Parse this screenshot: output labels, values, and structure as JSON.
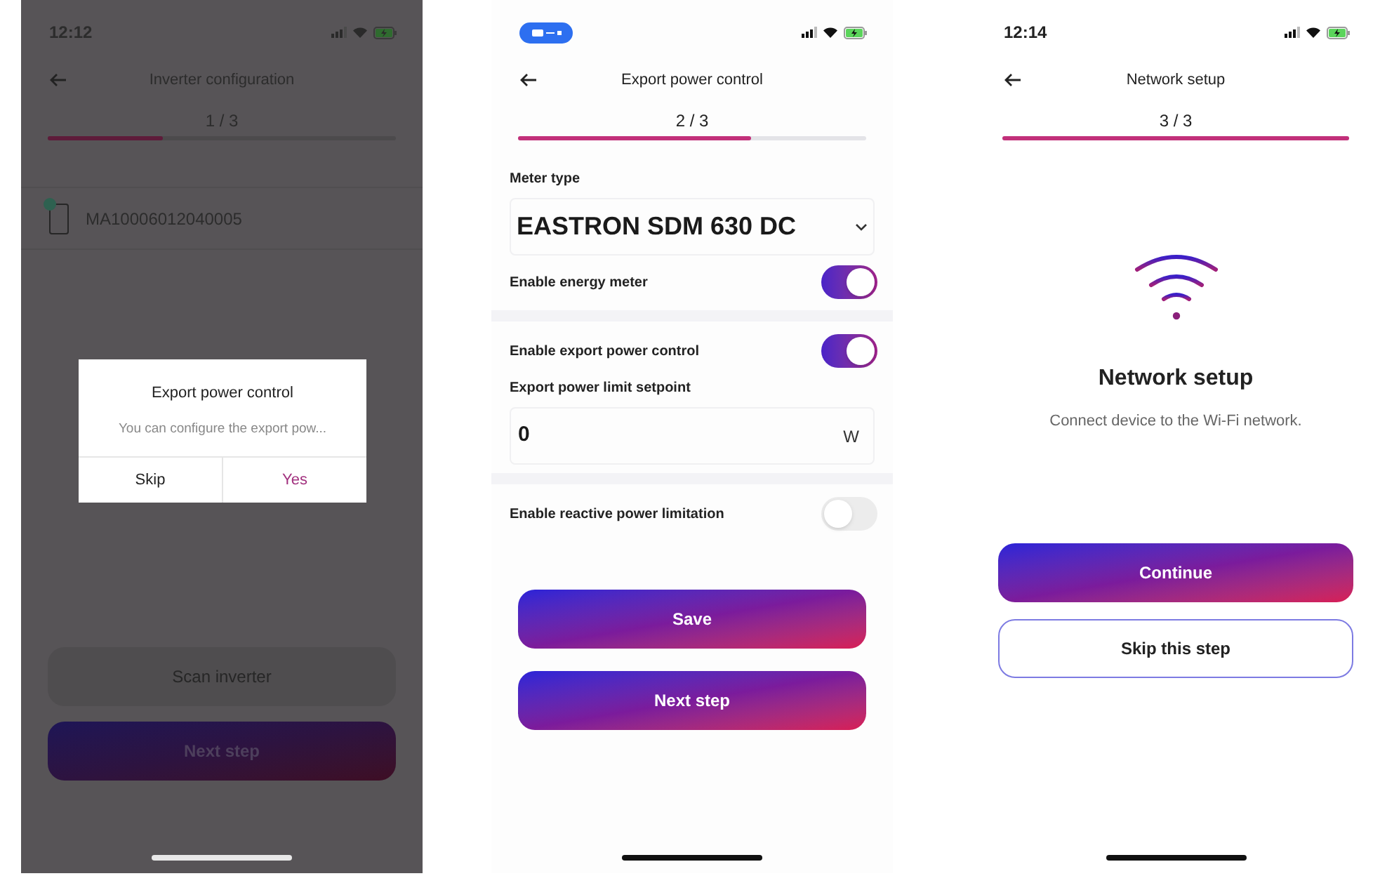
{
  "screens": [
    {
      "kind": "inverter_config",
      "time": "12:12",
      "title": "Inverter configuration",
      "step": "1 / 3",
      "progress": {
        "level": 0.33
      },
      "devices": [
        {
          "serial": "MA10006012040005",
          "connected": true
        }
      ],
      "dialog": {
        "title": "Export power control",
        "message": "You can configure the export pow...",
        "buttons": [
          {
            "label": "Skip",
            "primary": false
          },
          {
            "label": "Yes",
            "primary": true
          }
        ]
      },
      "buttons": [
        {
          "label": "Scan inverter",
          "kind": "secondary"
        },
        {
          "label": "Next step",
          "kind": "gradient"
        }
      ]
    },
    {
      "kind": "export_power",
      "title": "Export power control",
      "step": "2 / 3",
      "progress": {
        "level": 0.67
      },
      "sections": [
        {
          "items": [
            {
              "kind": "select",
              "label": "Meter type",
              "value": "EASTRON SDM 630 DC"
            },
            {
              "kind": "toggle",
              "label": "Enable energy meter",
              "on": true
            }
          ]
        },
        {
          "items": [
            {
              "kind": "toggle",
              "label": "Enable export power control",
              "on": true
            },
            {
              "kind": "number",
              "label": "Export power limit setpoint",
              "value": "0",
              "unit": "W"
            }
          ]
        },
        {
          "items": [
            {
              "kind": "toggle",
              "label": "Enable reactive power limitation",
              "on": false
            }
          ]
        }
      ],
      "buttons": [
        {
          "label": "Save",
          "kind": "gradient"
        },
        {
          "label": "Next step",
          "kind": "gradient"
        }
      ]
    },
    {
      "kind": "network_setup",
      "time": "12:14",
      "title": "Network setup",
      "step": "3 / 3",
      "progress": {
        "level": 1
      },
      "heading": "Network setup",
      "description": "Connect device to the Wi-Fi network.",
      "buttons": [
        {
          "label": "Continue",
          "kind": "gradient"
        },
        {
          "label": "Skip this step",
          "kind": "outline"
        }
      ]
    }
  ]
}
